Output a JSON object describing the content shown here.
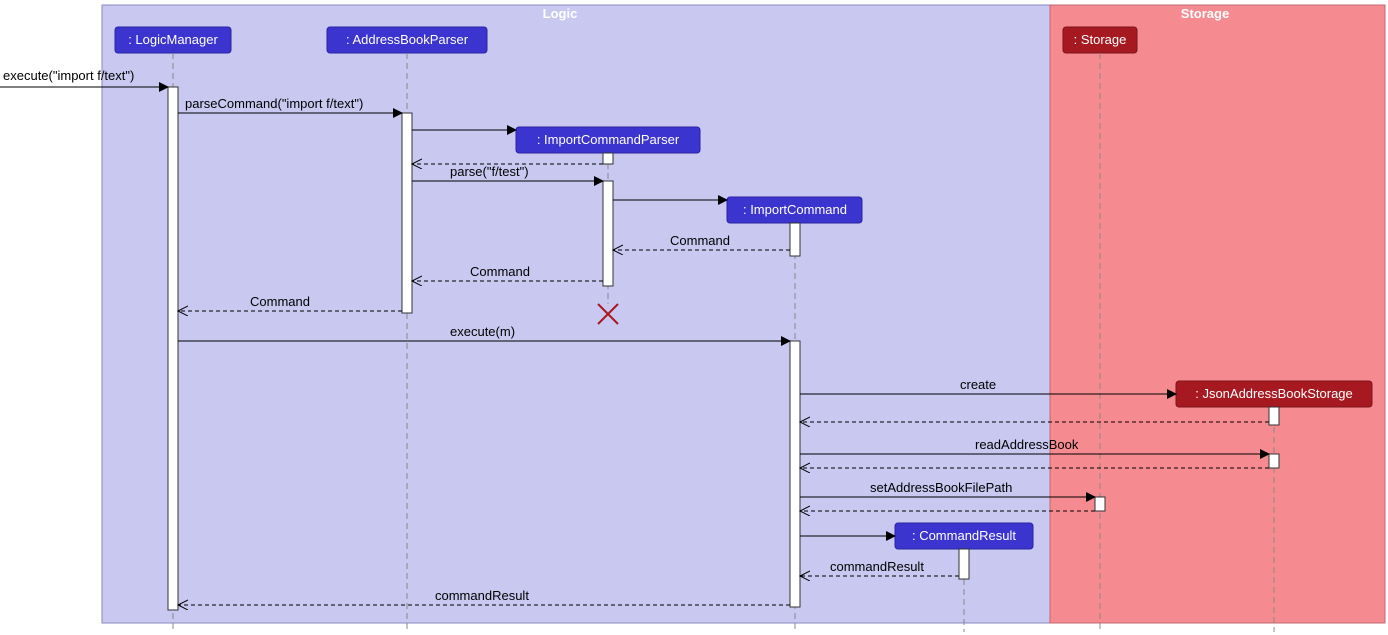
{
  "frames": {
    "logic": {
      "title": "Logic"
    },
    "storage": {
      "title": "Storage"
    }
  },
  "lifelines": {
    "logicManager": ": LogicManager",
    "addressBookParser": ": AddressBookParser",
    "importCommandParser": ": ImportCommandParser",
    "importCommand": ": ImportCommand",
    "commandResult": ": CommandResult",
    "storage": ": Storage",
    "jsonAddressBookStorage": ": JsonAddressBookStorage"
  },
  "messages": {
    "m1": "execute(\"import f/text\")",
    "m2": "parseCommand(\"import f/text\")",
    "m3": "parse(\"f/test\")",
    "m4_ret": "Command",
    "m5_ret": "Command",
    "m6_ret": "Command",
    "m7": "execute(m)",
    "m8": "create",
    "m9": "readAddressBook",
    "m10": "setAddressBookFilePath",
    "m11_ret": "commandResult",
    "m12_ret": "commandResult"
  }
}
